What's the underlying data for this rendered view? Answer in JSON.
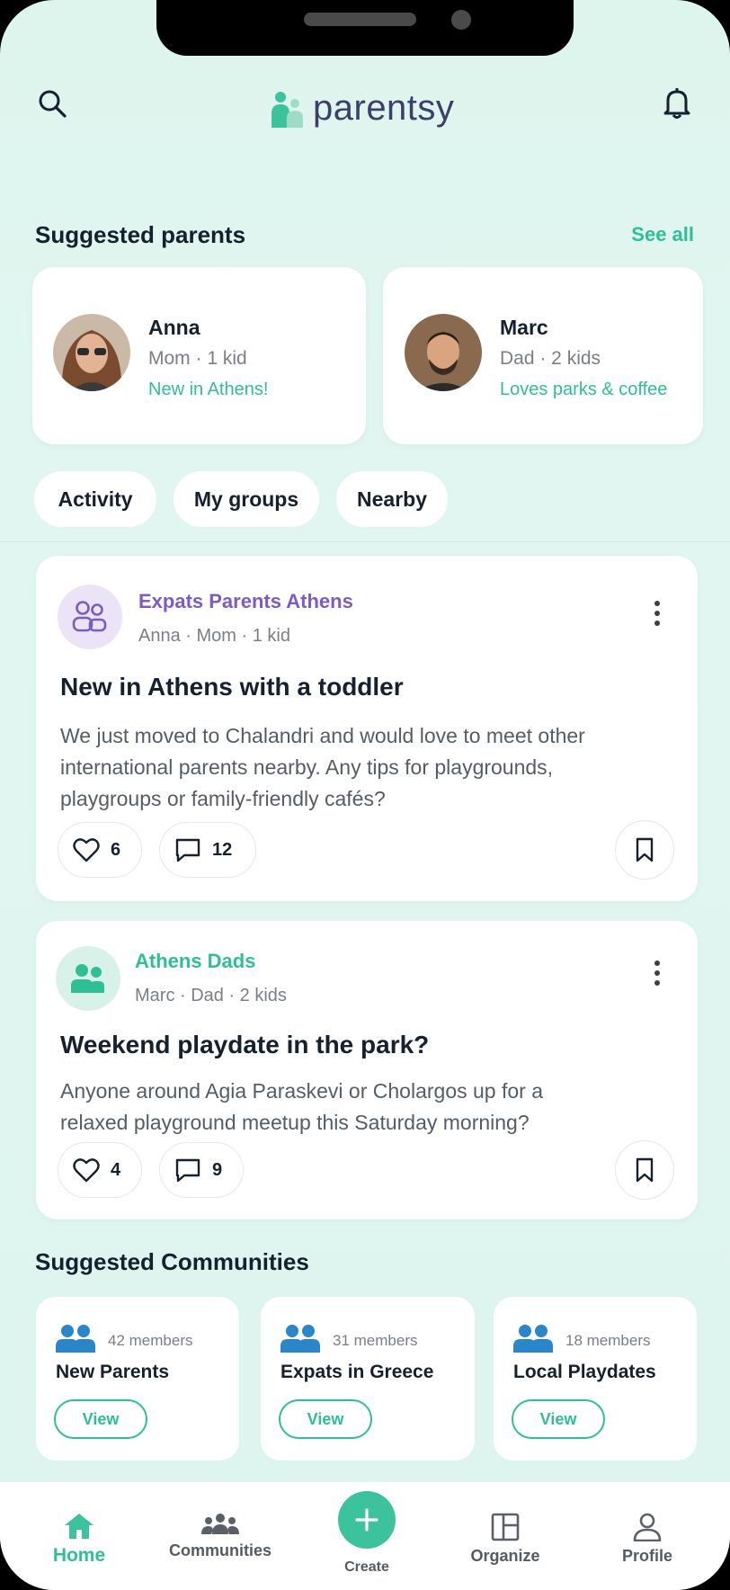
{
  "app": {
    "name": "parentsy"
  },
  "colors": {
    "accent": "#2fbf95",
    "purple": "#7c5cc4",
    "text": "#16202e"
  },
  "suggested_parents": {
    "title": "Suggested parents",
    "see_all": "See all",
    "items": [
      {
        "name": "Anna",
        "meta": "Mom · 1 kid",
        "tag": "New in Athens!"
      },
      {
        "name": "Marc",
        "meta": "Dad · 2 kids",
        "tag": "Loves parks & coffee"
      }
    ]
  },
  "filters": [
    "Activity",
    "My groups",
    "Nearby"
  ],
  "posts": [
    {
      "group": "Expats Parents Athens",
      "author": "Anna · Mom · 1 kid",
      "title": "New in Athens with a toddler",
      "body": "We just moved to Chalandri and would love to meet other international parents nearby. Any tips for playgrounds, playgroups or family-friendly cafés?",
      "likes": "6",
      "comments": "12"
    },
    {
      "group": "Athens Dads",
      "author": "Marc · Dad · 2 kids",
      "title": "Weekend playdate in the park?",
      "body": "Anyone around Agia Paraskevi or Cholargos up for a relaxed playground meetup this Saturday morning?",
      "likes": "4",
      "comments": "9"
    }
  ],
  "communities": {
    "title": "Suggested Communities",
    "items": [
      {
        "members": "42 members",
        "name": "New Parents",
        "action": "View"
      },
      {
        "members": "31 members",
        "name": "Expats in Greece",
        "action": "View"
      },
      {
        "members": "18 members",
        "name": "Local Playdates",
        "action": "View"
      }
    ]
  },
  "nav": {
    "home": "Home",
    "communities": "Communities",
    "create": "Create",
    "organize": "Organize",
    "profile": "Profile"
  }
}
